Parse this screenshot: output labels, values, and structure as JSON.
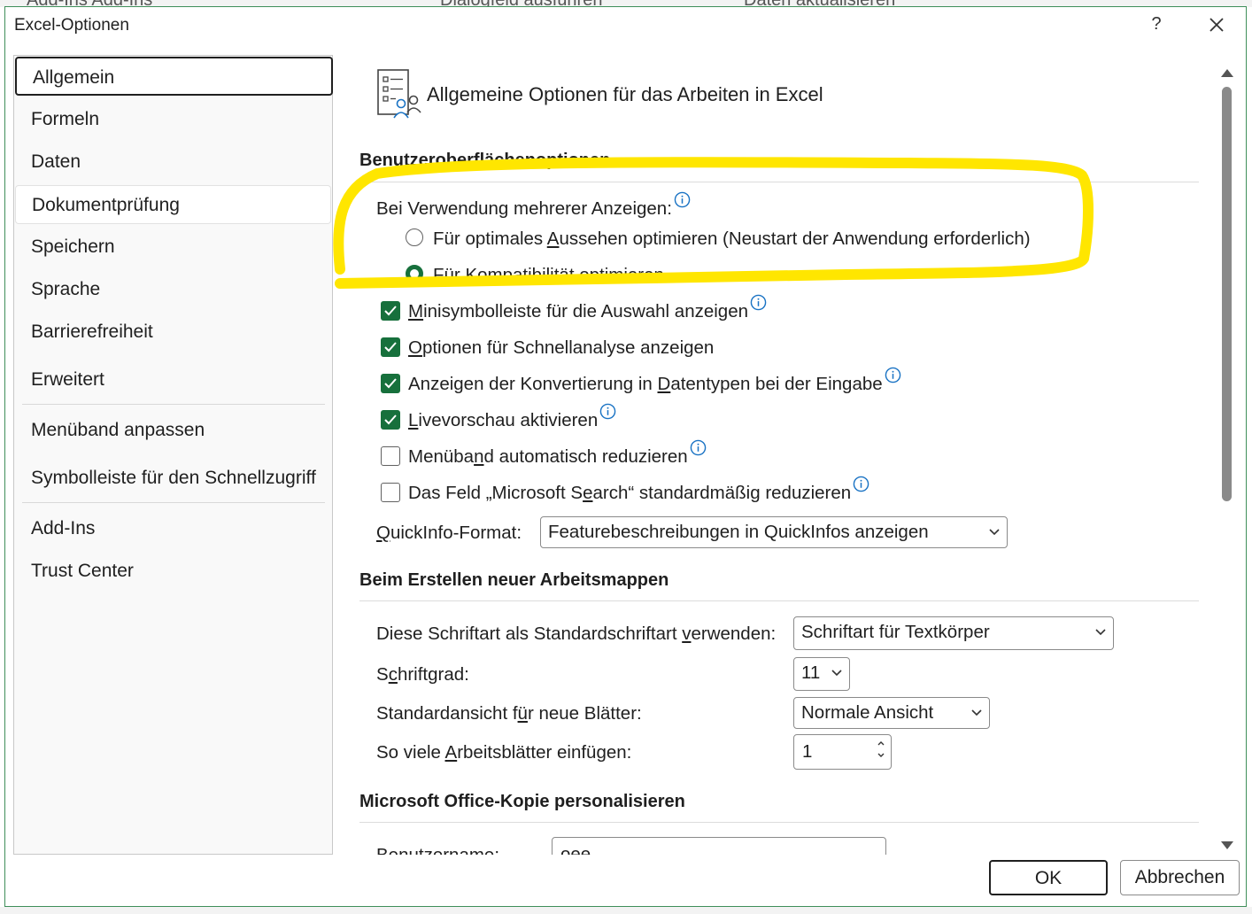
{
  "background": {
    "ribbon_items": [
      "Add-Ins Add-Ins",
      "Dialogfeld ausführen",
      "Daten aktualisieren"
    ]
  },
  "dialog": {
    "title": "Excel-Optionen",
    "help_label": "?",
    "close_icon": "close-icon"
  },
  "nav": {
    "items": [
      {
        "label": "Allgemein",
        "state": "selected"
      },
      {
        "label": "Formeln"
      },
      {
        "label": "Daten"
      },
      {
        "label": "Dokumentprüfung",
        "state": "hover"
      },
      {
        "label": "Speichern"
      },
      {
        "label": "Sprache"
      },
      {
        "label": "Barrierefreiheit"
      },
      {
        "label": "Erweitert"
      },
      {
        "label": "Menüband anpassen"
      },
      {
        "label": "Symbolleiste für den Schnellzugriff"
      },
      {
        "label": "Add-Ins"
      },
      {
        "label": "Trust Center"
      }
    ]
  },
  "header": {
    "icon": "general-options-icon",
    "title": "Allgemeine Optionen für das Arbeiten in Excel"
  },
  "ui_options": {
    "section_title": "Benutzeroberflächenoptionen",
    "multi_display_label": "Bei Verwendung mehrerer Anzeigen:",
    "radio_appearance": {
      "pre": "Für optimales ",
      "u": "A",
      "post": "ussehen optimieren (Neustart der Anwendung erforderlich)",
      "checked": false
    },
    "radio_compat": {
      "pre": "Für ",
      "u": "K",
      "post": "ompatibilität optimieren",
      "checked": true
    },
    "checkboxes": [
      {
        "pre": "",
        "u": "M",
        "post": "inisymbolleiste für die Auswahl anzeigen",
        "checked": true,
        "info": true
      },
      {
        "pre": "",
        "u": "O",
        "post": "ptionen für Schnellanalyse anzeigen",
        "checked": true,
        "info": false
      },
      {
        "pre": "Anzeigen der Konvertierung in ",
        "u": "D",
        "post": "atentypen bei der Eingabe",
        "checked": true,
        "info": true
      },
      {
        "pre": "",
        "u": "L",
        "post": "ivevorschau aktivieren",
        "checked": true,
        "info": true
      },
      {
        "pre": "Menüba",
        "u": "n",
        "post": "d automatisch reduzieren",
        "checked": false,
        "info": true
      },
      {
        "pre": "Das Feld „Microsoft S",
        "u": "e",
        "post": "arch“ standardmäßig reduzieren",
        "checked": false,
        "info": true
      }
    ],
    "quickinfo_label_pre": "",
    "quickinfo_label_u": "Q",
    "quickinfo_label_post": "uickInfo-Format:",
    "quickinfo_value": "Featurebeschreibungen in QuickInfos anzeigen"
  },
  "new_workbooks": {
    "section_title": "Beim Erstellen neuer Arbeitsmappen",
    "font_label_pre": "Diese Schriftart als Standardschriftart ",
    "font_label_u": "v",
    "font_label_post": "erwenden:",
    "font_value": "Schriftart für Textkörper",
    "size_label_pre": "S",
    "size_label_u": "c",
    "size_label_post": "hriftgrad:",
    "size_value": "11",
    "view_label_pre": "Standardansicht f",
    "view_label_u": "ü",
    "view_label_post": "r neue Blätter:",
    "view_value": "Normale Ansicht",
    "sheets_label_pre": "So viele ",
    "sheets_label_u": "A",
    "sheets_label_post": "rbeitsblätter einfügen:",
    "sheets_value": "1"
  },
  "personalize": {
    "section_title": "Microsoft Office-Kopie personalisieren",
    "username_label": "Benutzername:",
    "username_value": "oee"
  },
  "buttons": {
    "ok": "OK",
    "cancel": "Abbrechen"
  },
  "colors": {
    "accent_green": "#17703c",
    "dialog_border": "#3f8f5a",
    "info_blue": "#1a73c4",
    "highlight_yellow": "#ffe600"
  }
}
